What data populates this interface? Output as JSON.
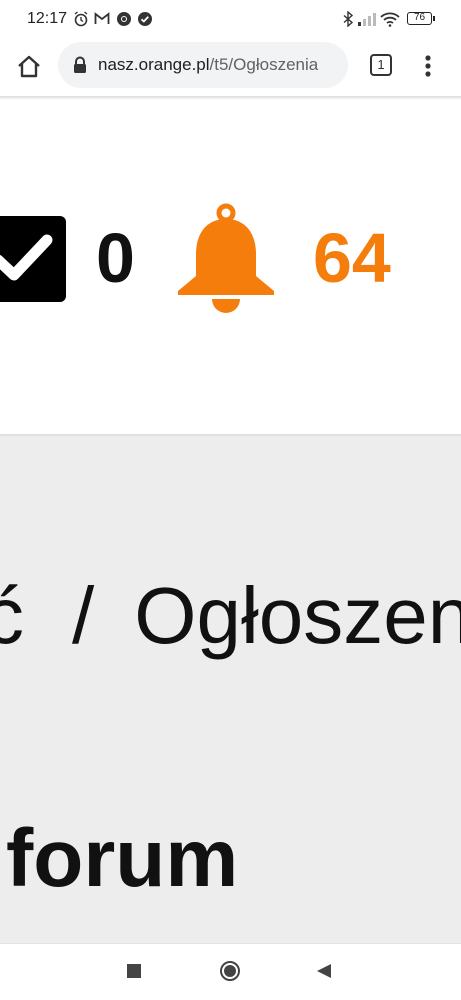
{
  "status_bar": {
    "time": "12:17",
    "battery": "76",
    "left_icons": [
      "alarm-icon",
      "gmail-icon",
      "chrome-icon",
      "check-circle-icon"
    ],
    "right_icons": [
      "bluetooth-icon",
      "signal-icon",
      "wifi-icon",
      "battery-icon"
    ]
  },
  "toolbar": {
    "url_host": "nasz.orange.pl",
    "url_path": "/t5/Ogłoszenia",
    "tab_count": "1"
  },
  "counters": {
    "checked_count": "0",
    "notifications_count": "64",
    "accent_color": "#f47d0b"
  },
  "content": {
    "breadcrumb_prev": "ć",
    "breadcrumb_sep": "/",
    "breadcrumb_current": "Ogłoszenia",
    "forum_title": "forum"
  }
}
